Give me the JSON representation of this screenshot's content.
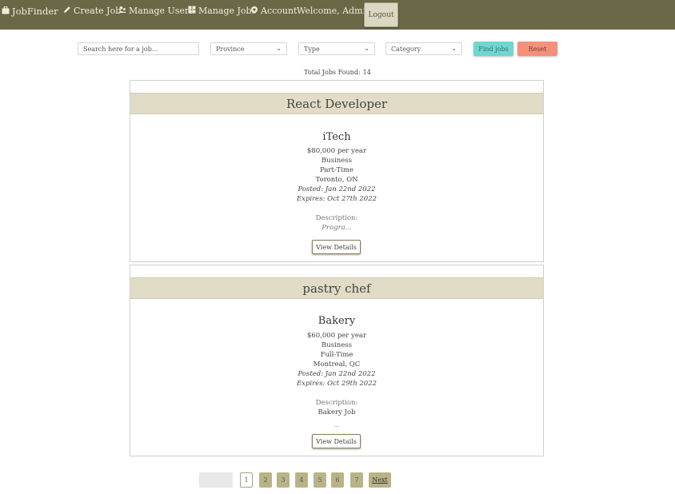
{
  "navbar": {
    "brand": "JobFinder",
    "brand_icon": "briefcase-icon",
    "items": [
      {
        "label": "Create Job",
        "icon": "pencil-icon"
      },
      {
        "label": "Manage Users",
        "icon": "users-icon"
      },
      {
        "label": "Manage Jobs",
        "icon": "grid-icon"
      },
      {
        "label": "Account",
        "icon": "account-icon"
      }
    ],
    "welcome": "Welcome, Admin",
    "logout": "Logout"
  },
  "filters": {
    "search_placeholder": "Search here for a job...",
    "province": "Province",
    "type": "Type",
    "category": "Category",
    "find_button": "Find jobs",
    "reset_button": "Reset"
  },
  "results": {
    "total_label": "Total Jobs Found:",
    "total_count": "14"
  },
  "jobs": [
    {
      "title": "React Developer",
      "company": "iTech",
      "salary": "$80,000 per year",
      "category": "Business",
      "type": "Part-Time",
      "location": "Toronto, ON",
      "posted": "Posted: Jan 22nd 2022",
      "expires": "Expires: Oct 27th 2022",
      "description_label": "Description:",
      "description": "Progra...",
      "details_button": "View Details"
    },
    {
      "title": "pastry chef",
      "company": "Bakery",
      "salary": "$60,000 per year",
      "category": "Business",
      "type": "Full-Time",
      "location": "Montreal, QC",
      "posted": "Posted: Jan 22nd 2022",
      "expires": "Expires: Oct 29th 2022",
      "description_label": "Description:",
      "description": "Bakery Job",
      "description_more": "...",
      "details_button": "View Details"
    }
  ],
  "pagination": {
    "pages": [
      "1",
      "2",
      "3",
      "4",
      "5",
      "6",
      "7"
    ],
    "current": "1",
    "next": "Next"
  },
  "colors": {
    "navbar": "#6b6847",
    "card_header": "#e0dcc6",
    "find_button": "#6fd6d0",
    "reset_button": "#f5907a",
    "page_button": "#b9b487"
  }
}
